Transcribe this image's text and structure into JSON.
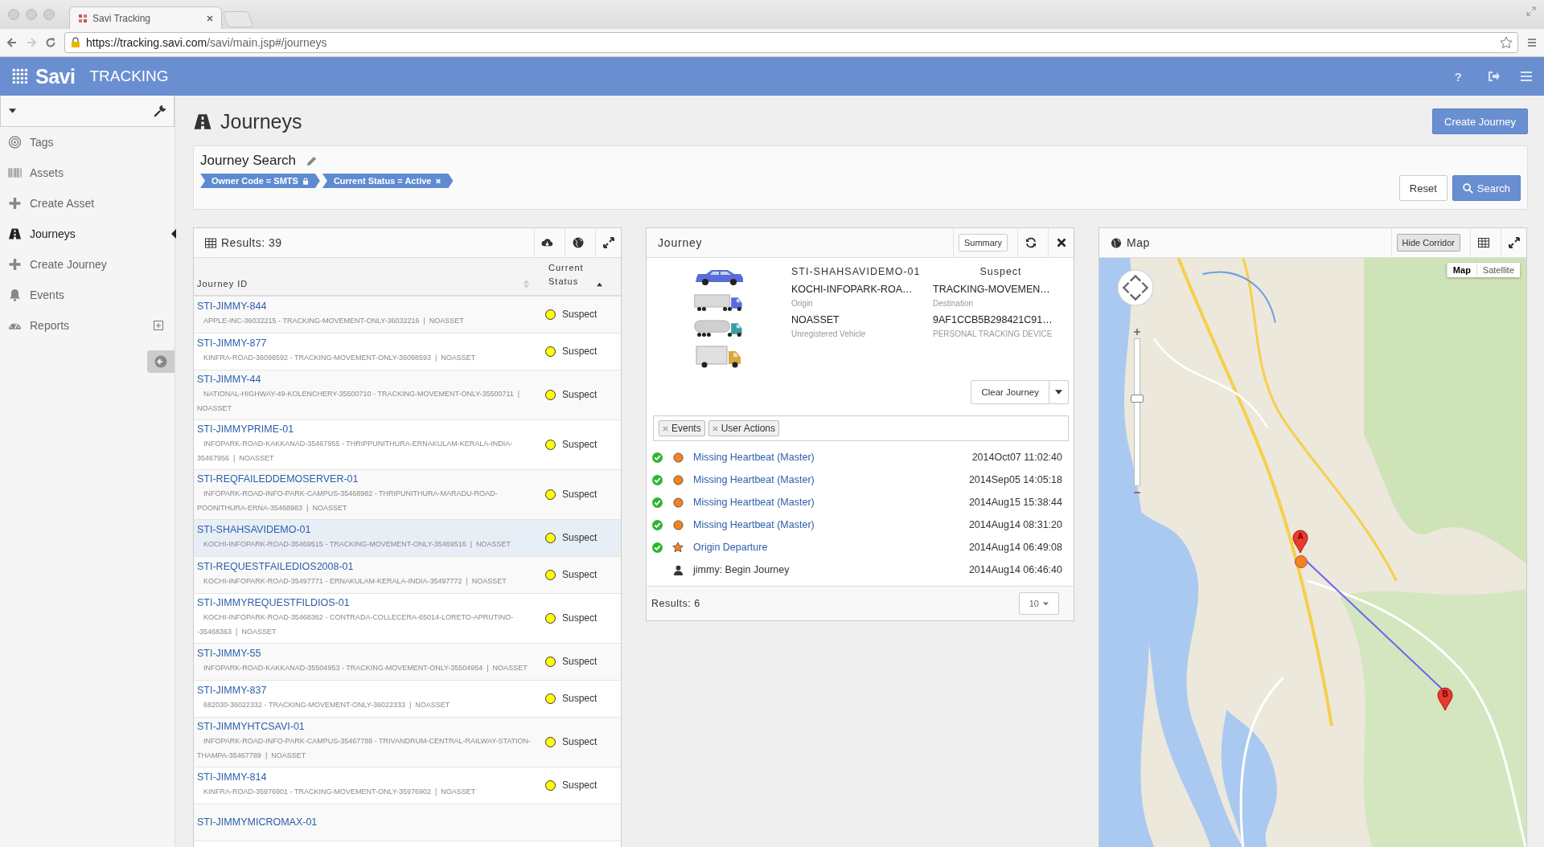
{
  "browser": {
    "tab_title": "Savi Tracking",
    "url_host": "https://tracking.savi.com",
    "url_path": "/savi/main.jsp#/journeys"
  },
  "app_bar": {
    "logo": "Savi",
    "product": "TRACKING",
    "help": "?"
  },
  "sidebar": {
    "items": [
      {
        "label": "Tags",
        "kind": "tags",
        "selected": false
      },
      {
        "label": "Assets",
        "kind": "assets",
        "selected": false
      },
      {
        "label": "Create Asset",
        "kind": "create",
        "selected": false
      },
      {
        "label": "Journeys",
        "kind": "journeys",
        "selected": true
      },
      {
        "label": "Create Journey",
        "kind": "create",
        "selected": false
      },
      {
        "label": "Events",
        "kind": "events",
        "selected": false
      },
      {
        "label": "Reports",
        "kind": "reports",
        "selected": false,
        "expanded": false
      }
    ]
  },
  "page": {
    "title": "Journeys",
    "create_button": "Create Journey"
  },
  "search": {
    "title": "Journey Search",
    "filters": [
      {
        "label": "Owner Code = SMTS",
        "kind": "locked"
      },
      {
        "label": "Current Status = Active",
        "kind": "removable"
      }
    ],
    "reset": "Reset",
    "submit": "Search"
  },
  "results": {
    "title": "Results: 39",
    "columns": [
      {
        "label": "Journey ID",
        "sorted": false
      },
      {
        "label": "Current Status",
        "sorted": true
      }
    ],
    "rows": [
      {
        "id": "STI-JIMMY-844",
        "detail": "APPLE-INC-36032215 - TRACKING-MOVEMENT-ONLY-36032216  |  NOASSET",
        "status": "Suspect",
        "selected": false
      },
      {
        "id": "STI-JIMMY-877",
        "detail": "KINFRA-ROAD-36098592 - TRACKING-MOVEMENT-ONLY-36098593  |  NOASSET",
        "status": "Suspect",
        "selected": false
      },
      {
        "id": "STI-JIMMY-44",
        "detail": "NATIONAL-HIGHWAY-49-KOLENCHERY-35500710 - TRACKING-MOVEMENT-ONLY-35500711  |  NOASSET",
        "status": "Suspect",
        "selected": false
      },
      {
        "id": "STI-JIMMYPRIME-01",
        "detail": "INFOPARK-ROAD-KAKKANAD-35467955 - THRIPPUNITHURA-ERNAKULAM-KERALA-INDIA-35467956  |  NOASSET",
        "status": "Suspect",
        "selected": false
      },
      {
        "id": "STI-REQFAILEDDEMOSERVER-01",
        "detail": "INFOPARK-ROAD-INFO-PARK-CAMPUS-35468982 - THRIPUNITHURA-MARADU-ROAD-POONITHURA-ERNA-35468983  |  NOASSET",
        "status": "Suspect",
        "selected": false
      },
      {
        "id": "STI-SHAHSAVIDEMO-01",
        "detail": "KOCHI-INFOPARK-ROAD-35469515 - TRACKING-MOVEMENT-ONLY-35469516  |  NOASSET",
        "status": "Suspect",
        "selected": true
      },
      {
        "id": "STI-REQUESTFAILEDIOS2008-01",
        "detail": "KOCHI-INFOPARK-ROAD-35497771 - ERNAKULAM-KERALA-INDIA-35497772  |  NOASSET",
        "status": "Suspect",
        "selected": false
      },
      {
        "id": "STI-JIMMYREQUESTFILDIOS-01",
        "detail": "KOCHI-INFOPARK-ROAD-35468362 - CONTRADA-COLLECERA-65014-LORETO-APRUTINO--35468363  |  NOASSET",
        "status": "Suspect",
        "selected": false
      },
      {
        "id": "STI-JIMMY-55",
        "detail": "INFOPARK-ROAD-KAKKANAD-35504953 - TRACKING-MOVEMENT-ONLY-35504954  |  NOASSET",
        "status": "Suspect",
        "selected": false
      },
      {
        "id": "STI-JIMMY-837",
        "detail": "682030-36022332 - TRACKING-MOVEMENT-ONLY-36022333  |  NOASSET",
        "status": "Suspect",
        "selected": false
      },
      {
        "id": "STI-JIMMYHTCSAVI-01",
        "detail": "INFOPARK-ROAD-INFO-PARK-CAMPUS-35467788 - TRIVANDRUM-CENTRAL-RAILWAY-STATION-THAMPA-35467789  |  NOASSET",
        "status": "Suspect",
        "selected": false
      },
      {
        "id": "STI-JIMMY-814",
        "detail": "KINFRA-ROAD-35976901 - TRACKING-MOVEMENT-ONLY-35976902  |  NOASSET",
        "status": "Suspect",
        "selected": false
      },
      {
        "id": "STI-JIMMYMICROMAX-01",
        "status": "",
        "selected": false
      }
    ]
  },
  "journey": {
    "title": "Journey",
    "summary_button": "Summary",
    "id": "STI-SHAHSAVIDEMO-01",
    "status": "Suspect",
    "fields": [
      {
        "value": "KOCHI-INFOPARK-ROA…",
        "label": "Origin"
      },
      {
        "value": "TRACKING-MOVEMEN…",
        "label": "Destination"
      },
      {
        "value": "NOASSET",
        "label": "Unregistered Vehicle"
      },
      {
        "value": "9AF1CCB5B298421C91…",
        "label": "PERSONAL TRACKING DEVICE"
      }
    ],
    "clear_button": "Clear Journey",
    "filter_tags": [
      "Events",
      "User Actions"
    ],
    "events": [
      {
        "kind": "alert",
        "acknowledged": true,
        "text": "Missing Heartbeat (Master)",
        "time": "2014Oct07 11:02:40"
      },
      {
        "kind": "alert",
        "acknowledged": true,
        "text": "Missing Heartbeat (Master)",
        "time": "2014Sep05 14:05:18"
      },
      {
        "kind": "alert",
        "acknowledged": true,
        "text": "Missing Heartbeat (Master)",
        "time": "2014Aug15 15:38:44"
      },
      {
        "kind": "alert",
        "acknowledged": true,
        "text": "Missing Heartbeat (Master)",
        "time": "2014Aug14 08:31:20"
      },
      {
        "kind": "milestone",
        "acknowledged": true,
        "text": "Origin Departure",
        "time": "2014Aug14 06:49:08"
      },
      {
        "kind": "user",
        "acknowledged": false,
        "text": "jimmy: Begin Journey",
        "time": "2014Aug14 06:46:40"
      }
    ],
    "footer": "Results: 6",
    "page_size": "10"
  },
  "map": {
    "title": "Map",
    "hide_corridor": "Hide Corridor",
    "map_types": [
      {
        "label": "Map",
        "selected": true
      },
      {
        "label": "Satellite",
        "selected": false
      }
    ],
    "zoom": {
      "level": 0.6
    },
    "markers": [
      {
        "label": "A"
      },
      {
        "label": "B"
      }
    ]
  }
}
